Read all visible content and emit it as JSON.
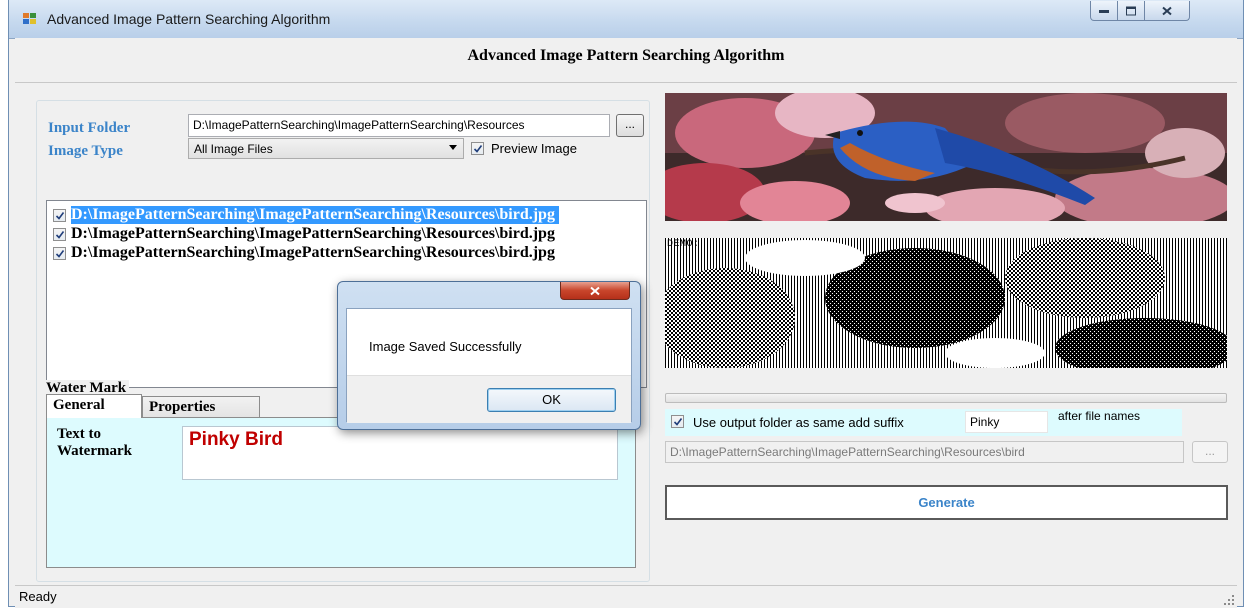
{
  "window": {
    "title": "Advanced Image Pattern Searching Algorithm",
    "controls": [
      "minimize",
      "maximize",
      "close"
    ]
  },
  "form": {
    "header": "Advanced Image Pattern Searching Algorithm"
  },
  "input_folder": {
    "label": "Input Folder",
    "value": "D:\\ImagePatternSearching\\ImagePatternSearching\\Resources",
    "browse_label": "..."
  },
  "image_type": {
    "label": "Image Type",
    "selected": "All Image Files"
  },
  "preview_image": {
    "label": "Preview Image",
    "checked": true
  },
  "file_list": [
    {
      "path": "D:\\ImagePatternSearching\\ImagePatternSearching\\Resources\\bird.jpg",
      "checked": true,
      "selected": true
    },
    {
      "path": "D:\\ImagePatternSearching\\ImagePatternSearching\\Resources\\bird.jpg",
      "checked": true,
      "selected": false
    },
    {
      "path": "D:\\ImagePatternSearching\\ImagePatternSearching\\Resources\\bird.jpg",
      "checked": true,
      "selected": false
    }
  ],
  "watermark": {
    "group_label": "Water Mark",
    "tabs": [
      {
        "label": "General",
        "active": true
      },
      {
        "label": "Properties",
        "active": false
      }
    ],
    "text_label": "Text to Watermark",
    "text_value": "Pinky Bird"
  },
  "preview": {
    "demo_text": "DEMO:"
  },
  "output": {
    "same_folder_label": "Use output folder as same add suffix",
    "same_folder_checked": true,
    "suffix_value": "Pinky",
    "after_label": "after file names",
    "folder_value": "D:\\ImagePatternSearching\\ImagePatternSearching\\Resources\\bird",
    "browse_label": "..."
  },
  "generate_label": "Generate",
  "status": {
    "text": "Ready"
  },
  "dialog": {
    "message": "Image Saved Successfully",
    "ok_label": "OK"
  },
  "colors": {
    "label_blue": "#3b84c9",
    "tab_page_bg": "#ddfbfe",
    "watermark_text": "#c00000",
    "selection": "#3399ff"
  }
}
